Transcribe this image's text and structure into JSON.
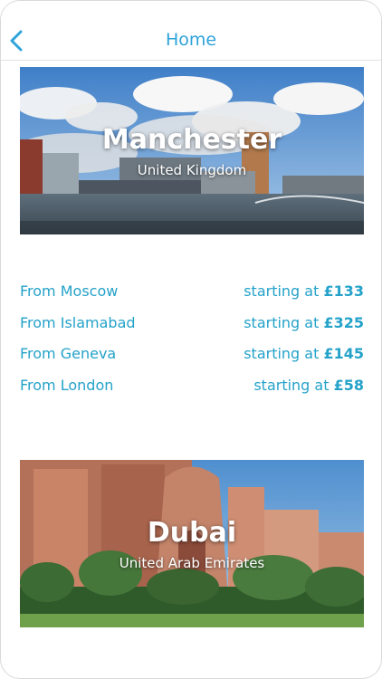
{
  "nav": {
    "title": "Home"
  },
  "destinations": [
    {
      "city": "Manchester",
      "country": "United Kingdom",
      "routes": [
        {
          "from": "From Moscow",
          "prefix": "starting at",
          "price": "£133"
        },
        {
          "from": "From Islamabad",
          "prefix": "starting at",
          "price": "£325"
        },
        {
          "from": "From Geneva",
          "prefix": "starting at",
          "price": "£145"
        },
        {
          "from": "From London",
          "prefix": "starting at",
          "price": "£58"
        }
      ]
    },
    {
      "city": "Dubai",
      "country": "United Arab Emirates"
    }
  ],
  "colors": {
    "accent": "#2ea3d9",
    "route_text": "#24a2c9"
  },
  "icons": {
    "back": "chevron-left-icon"
  }
}
